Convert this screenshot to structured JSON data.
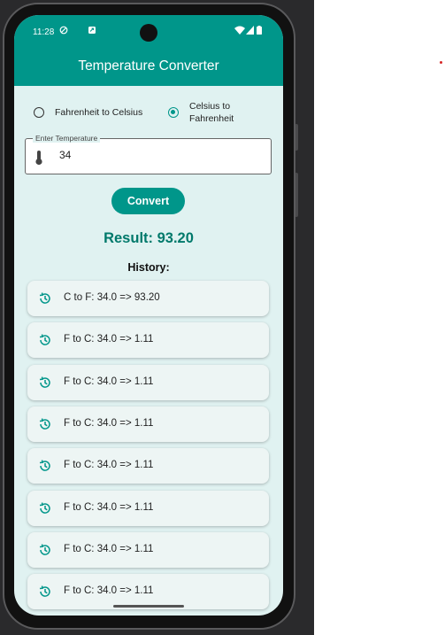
{
  "status_bar": {
    "time": "11:28"
  },
  "app_bar": {
    "title": "Temperature Converter"
  },
  "conversion_mode": {
    "options": [
      {
        "label": "Fahrenheit to Celsius",
        "selected": false
      },
      {
        "label": "Celsius to Fahrenheit",
        "selected": true
      }
    ]
  },
  "temperature_input": {
    "label": "Enter Temperature",
    "value": "34"
  },
  "convert_button": {
    "label": "Convert"
  },
  "result": {
    "text": "Result: 93.20"
  },
  "history": {
    "title": "History:",
    "items": [
      "C to F: 34.0 => 93.20",
      "F to C: 34.0 => 1.11",
      "F to C: 34.0 => 1.11",
      "F to C: 34.0 => 1.11",
      "F to C: 34.0 => 1.11",
      "F to C: 34.0 => 1.11",
      "F to C: 34.0 => 1.11",
      "F to C: 34.0 => 1.11"
    ]
  },
  "colors": {
    "primary": "#00968a",
    "result_text": "#00796b",
    "background": "#e0f2f1",
    "card": "#edf5f4"
  },
  "icons": {
    "history_item": "history-icon",
    "input_prefix": "thermometer-icon"
  }
}
